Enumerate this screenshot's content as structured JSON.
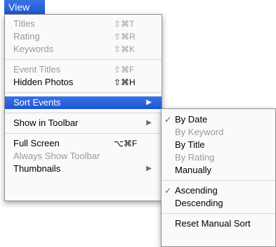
{
  "menu_title": "View",
  "main_menu": {
    "titles": {
      "label": "Titles",
      "shortcut": "⇧⌘T"
    },
    "rating": {
      "label": "Rating",
      "shortcut": "⇧⌘R"
    },
    "keywords": {
      "label": "Keywords",
      "shortcut": "⇧⌘K"
    },
    "event_titles": {
      "label": "Event Titles",
      "shortcut": "⇧⌘F"
    },
    "hidden_photos": {
      "label": "Hidden Photos",
      "shortcut": "⇧⌘H"
    },
    "sort_events": {
      "label": "Sort Events"
    },
    "show_in_toolbar": {
      "label": "Show in Toolbar"
    },
    "full_screen": {
      "label": "Full Screen",
      "shortcut": "⌥⌘F"
    },
    "always_show_toolbar": {
      "label": "Always Show Toolbar"
    },
    "thumbnails": {
      "label": "Thumbnails"
    }
  },
  "submenu": {
    "by_date": "By Date",
    "by_keyword": "By Keyword",
    "by_title": "By Title",
    "by_rating": "By Rating",
    "manually": "Manually",
    "ascending": "Ascending",
    "descending": "Descending",
    "reset_manual_sort": "Reset Manual Sort"
  },
  "icons": {
    "check": "✓",
    "submenu_arrow": "▶"
  },
  "colors": {
    "highlight": "#2a62db",
    "disabled_text": "#9a9a9a"
  }
}
